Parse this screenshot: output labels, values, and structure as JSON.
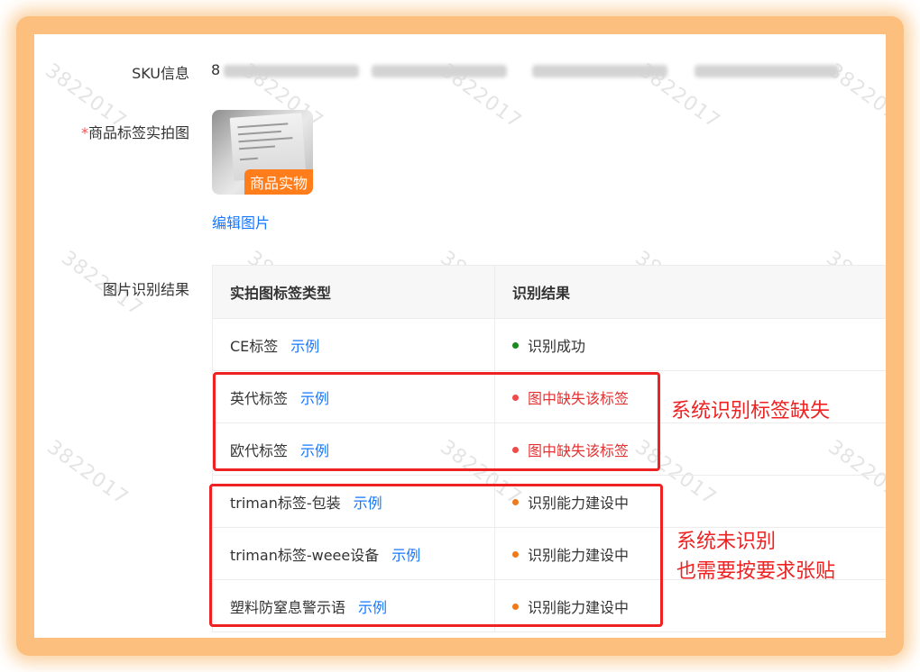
{
  "watermark": "3822017",
  "form": {
    "sku_label": "SKU信息",
    "sku_value_prefix": "8",
    "photo_label_required_mark": "*",
    "photo_label": "商品标签实拍图",
    "photo_tag": "商品实物",
    "edit_photo_link": "编辑图片",
    "recognition_label": "图片识别结果"
  },
  "table": {
    "headers": [
      "实拍图标签类型",
      "识别结果"
    ],
    "rows": [
      {
        "type": "CE标签",
        "example": "示例",
        "result": "识别成功",
        "status": "success"
      },
      {
        "type": "英代标签",
        "example": "示例",
        "result": "图中缺失该标签",
        "status": "missing"
      },
      {
        "type": "欧代标签",
        "example": "示例",
        "result": "图中缺失该标签",
        "status": "missing"
      },
      {
        "type": "triman标签-包装",
        "example": "示例",
        "result": "识别能力建设中",
        "status": "building"
      },
      {
        "type": "triman标签-weee设备",
        "example": "示例",
        "result": "识别能力建设中",
        "status": "building"
      },
      {
        "type": "塑料防窒息警示语",
        "example": "示例",
        "result": "识别能力建设中",
        "status": "building"
      }
    ]
  },
  "colors": {
    "success": "#1a8a1a",
    "missing": "#f04a4a",
    "building": "#f07a1a",
    "missing_text": "#e33232",
    "annotation": "#ee2222",
    "link": "#1677ff"
  },
  "annotations": {
    "missing_note": "系统识别标签缺失",
    "unrecognized_note_line1": "系统未识别",
    "unrecognized_note_line2": "也需要按要求张贴"
  }
}
